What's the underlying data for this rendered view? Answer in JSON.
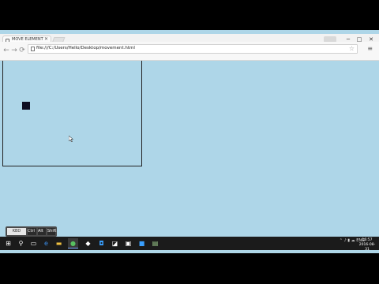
{
  "browser": {
    "tab_title": "MOVE ELEMENT",
    "tab_close": "✕",
    "url": "file:///C:/Users/Hello/Desktop/movement.html",
    "window_controls": {
      "minimize": "─",
      "maximize": "□",
      "close": "✕"
    }
  },
  "osd_buttons": [
    "Ctrl",
    "Alt",
    "Shift"
  ],
  "taskbar": {
    "time": "16:57",
    "date": "2016-08-31",
    "language": "ENG"
  }
}
